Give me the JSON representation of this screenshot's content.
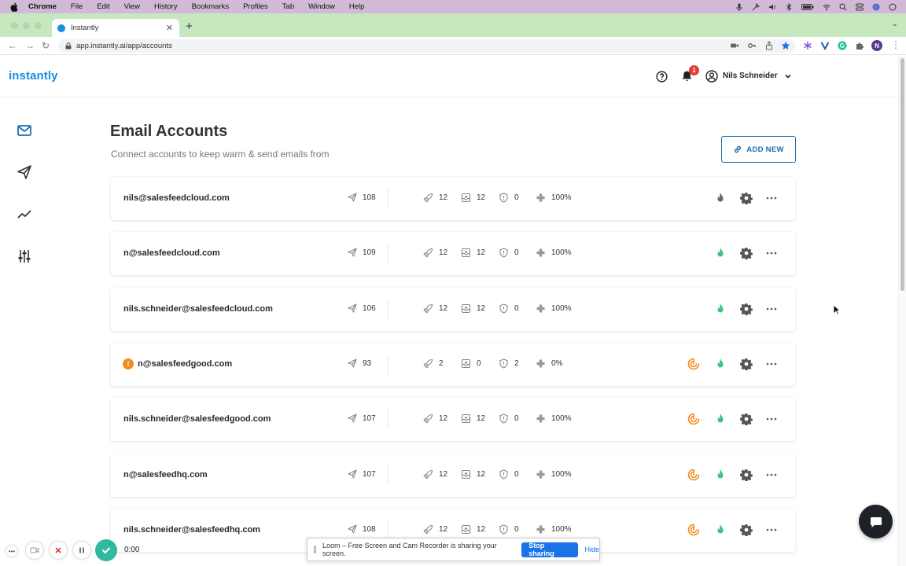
{
  "menubar": {
    "app": "Chrome",
    "items": [
      "File",
      "Edit",
      "View",
      "History",
      "Bookmarks",
      "Profiles",
      "Tab",
      "Window",
      "Help"
    ]
  },
  "browser": {
    "tab_title": "Instantly",
    "url": "app.instantly.ai/app/accounts",
    "profile_initial": "N"
  },
  "header": {
    "logo": "instantly",
    "notification_count": "1",
    "user_name": "Nils Schneider"
  },
  "main": {
    "title": "Email Accounts",
    "subtitle": "Connect accounts to keep warm & send emails from",
    "add_new_label": "ADD NEW"
  },
  "accounts": [
    {
      "email": "nils@salesfeedcloud.com",
      "sent": "108",
      "warmup": "12",
      "inbox": "12",
      "spam": "0",
      "health": "100%",
      "warning": false,
      "status_icon": false,
      "flame_color": "#666666"
    },
    {
      "email": "n@salesfeedcloud.com",
      "sent": "109",
      "warmup": "12",
      "inbox": "12",
      "spam": "0",
      "health": "100%",
      "warning": false,
      "status_icon": false,
      "flame_color": "#3cc47c"
    },
    {
      "email": "nils.schneider@salesfeedcloud.com",
      "sent": "106",
      "warmup": "12",
      "inbox": "12",
      "spam": "0",
      "health": "100%",
      "warning": false,
      "status_icon": false,
      "flame_color": "#3cc47c"
    },
    {
      "email": "n@salesfeedgood.com",
      "sent": "93",
      "warmup": "2",
      "inbox": "0",
      "spam": "2",
      "health": "0%",
      "warning": true,
      "status_icon": true,
      "flame_color": "#3cc47c"
    },
    {
      "email": "nils.schneider@salesfeedgood.com",
      "sent": "107",
      "warmup": "12",
      "inbox": "12",
      "spam": "0",
      "health": "100%",
      "warning": false,
      "status_icon": true,
      "flame_color": "#3cc47c"
    },
    {
      "email": "n@salesfeedhq.com",
      "sent": "107",
      "warmup": "12",
      "inbox": "12",
      "spam": "0",
      "health": "100%",
      "warning": false,
      "status_icon": true,
      "flame_color": "#3cc47c"
    },
    {
      "email": "nils.schneider@salesfeedhq.com",
      "sent": "108",
      "warmup": "12",
      "inbox": "12",
      "spam": "0",
      "health": "100%",
      "warning": false,
      "status_icon": true,
      "flame_color": "#3cc47c"
    }
  ],
  "loom": {
    "timer": "0:00",
    "share_message": "Loom – Free Screen and Cam Recorder is sharing your screen.",
    "stop_label": "Stop sharing",
    "hide_label": "Hide"
  },
  "colors": {
    "brand": "#1a8de0",
    "accent": "#1a6fb0",
    "warning": "#f28c1e",
    "flame_active": "#3cc47c",
    "badge": "#e53935"
  }
}
